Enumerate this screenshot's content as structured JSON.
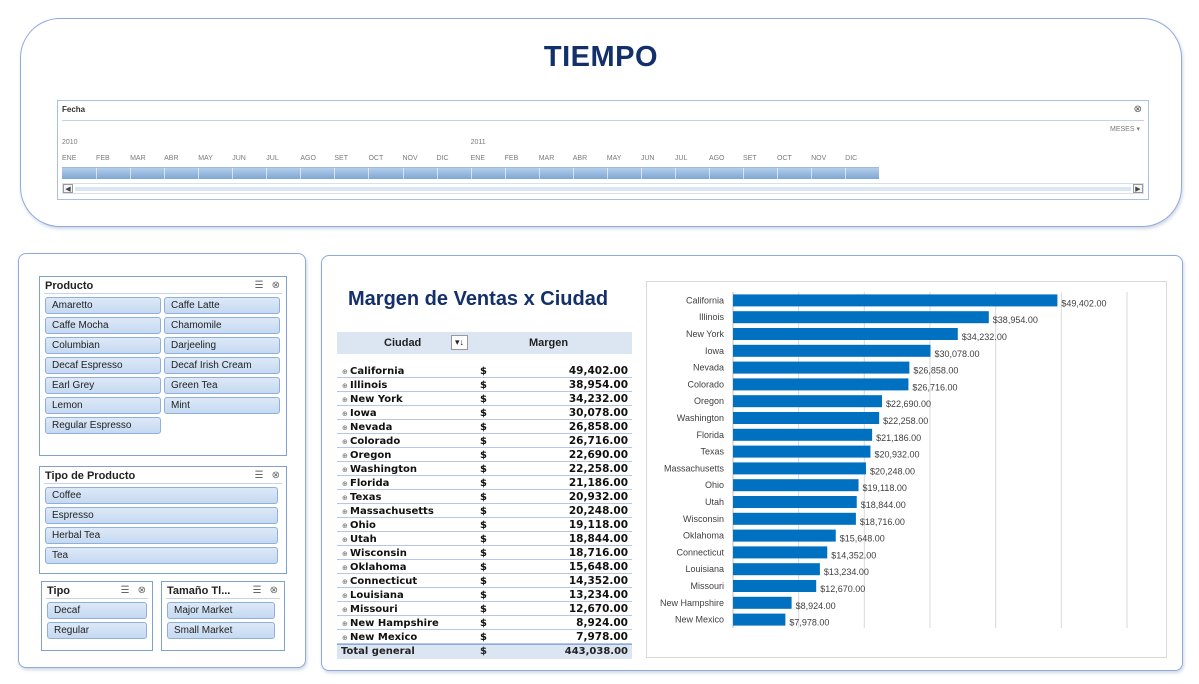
{
  "timeline": {
    "title": "TIEMPO",
    "header": "Fecha",
    "level": "MESES",
    "years": [
      "2010",
      "2011"
    ],
    "months": [
      "ENE",
      "FEB",
      "MAR",
      "ABR",
      "MAY",
      "JUN",
      "JUL",
      "AGO",
      "SET",
      "OCT",
      "NOV",
      "DIC"
    ],
    "selected_range": "ENE 2010 - DIC 2011"
  },
  "slicers": {
    "producto": {
      "title": "Producto",
      "items": [
        "Amaretto",
        "Caffe Latte",
        "Caffe Mocha",
        "Chamomile",
        "Columbian",
        "Darjeeling",
        "Decaf Espresso",
        "Decaf Irish Cream",
        "Earl Grey",
        "Green Tea",
        "Lemon",
        "Mint",
        "Regular Espresso"
      ]
    },
    "tipo_producto": {
      "title": "Tipo de Producto",
      "items": [
        "Coffee",
        "Espresso",
        "Herbal Tea",
        "Tea"
      ]
    },
    "tipo": {
      "title": "Tipo",
      "items": [
        "Decaf",
        "Regular"
      ]
    },
    "tamano": {
      "title": "Tamaño Tl...",
      "items": [
        "Major Market",
        "Small Market"
      ]
    }
  },
  "main": {
    "title": "Margen de Ventas x Ciudad"
  },
  "pivot": {
    "col_city": "Ciudad",
    "col_margin": "Margen",
    "currency": "$",
    "rows": [
      {
        "city": "California",
        "margin": "49,402.00"
      },
      {
        "city": "Illinois",
        "margin": "38,954.00"
      },
      {
        "city": "New York",
        "margin": "34,232.00"
      },
      {
        "city": "Iowa",
        "margin": "30,078.00"
      },
      {
        "city": "Nevada",
        "margin": "26,858.00"
      },
      {
        "city": "Colorado",
        "margin": "26,716.00"
      },
      {
        "city": "Oregon",
        "margin": "22,690.00"
      },
      {
        "city": "Washington",
        "margin": "22,258.00"
      },
      {
        "city": "Florida",
        "margin": "21,186.00"
      },
      {
        "city": "Texas",
        "margin": "20,932.00"
      },
      {
        "city": "Massachusetts",
        "margin": "20,248.00"
      },
      {
        "city": "Ohio",
        "margin": "19,118.00"
      },
      {
        "city": "Utah",
        "margin": "18,844.00"
      },
      {
        "city": "Wisconsin",
        "margin": "18,716.00"
      },
      {
        "city": "Oklahoma",
        "margin": "15,648.00"
      },
      {
        "city": "Connecticut",
        "margin": "14,352.00"
      },
      {
        "city": "Louisiana",
        "margin": "13,234.00"
      },
      {
        "city": "Missouri",
        "margin": "12,670.00"
      },
      {
        "city": "New Hampshire",
        "margin": "8,924.00"
      },
      {
        "city": "New Mexico",
        "margin": "7,978.00"
      }
    ],
    "total_label": "Total general",
    "total_value": "443,038.00"
  },
  "chart_data": {
    "type": "bar",
    "orientation": "horizontal",
    "categories": [
      "California",
      "Illinois",
      "New York",
      "Iowa",
      "Nevada",
      "Colorado",
      "Oregon",
      "Washington",
      "Florida",
      "Texas",
      "Massachusetts",
      "Ohio",
      "Utah",
      "Wisconsin",
      "Oklahoma",
      "Connecticut",
      "Louisiana",
      "Missouri",
      "New Hampshire",
      "New Mexico"
    ],
    "values": [
      49402,
      38954,
      34232,
      30078,
      26858,
      26716,
      22690,
      22258,
      21186,
      20932,
      20248,
      19118,
      18844,
      18716,
      15648,
      14352,
      13234,
      12670,
      8924,
      7978
    ],
    "data_labels": [
      "$49,402.00",
      "$38,954.00",
      "$34,232.00",
      "$30,078.00",
      "$26,858.00",
      "$26,716.00",
      "$22,690.00",
      "$22,258.00",
      "$21,186.00",
      "$20,932.00",
      "$20,248.00",
      "$19,118.00",
      "$18,844.00",
      "$18,716.00",
      "$15,648.00",
      "$14,352.00",
      "$13,234.00",
      "$12,670.00",
      "$8,924.00",
      "$7,978.00"
    ],
    "xlim": [
      0,
      60000
    ],
    "grid": true,
    "legend": "none",
    "bar_color": "#0070c0"
  },
  "colors": {
    "accent": "#14306a",
    "slicer_fill": "#c5d9f1",
    "header_fill": "#dce6f2",
    "bar": "#0070c0"
  }
}
